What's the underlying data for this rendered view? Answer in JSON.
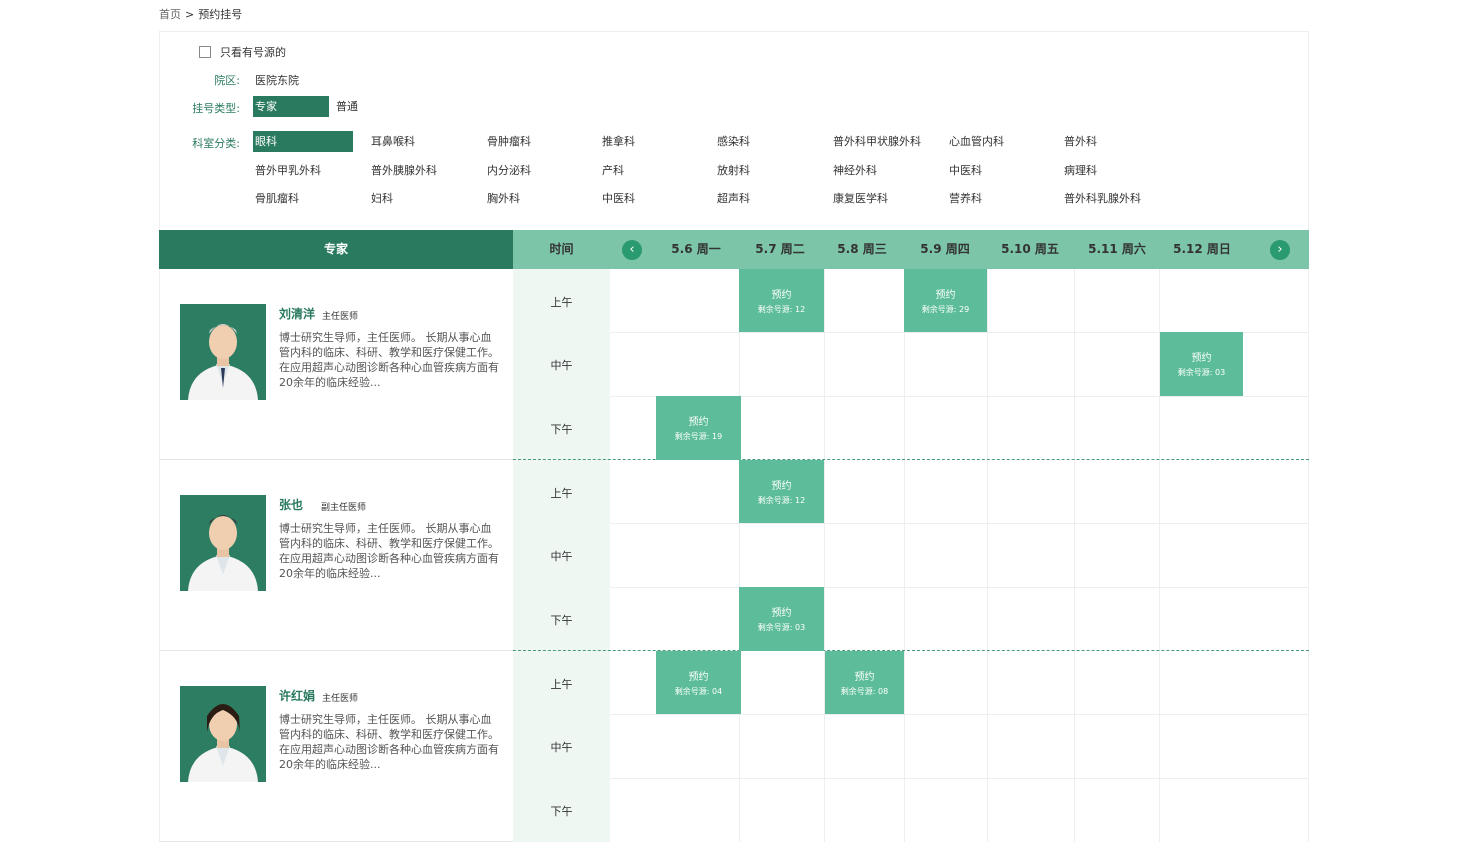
{
  "breadcrumb": {
    "home": "首页",
    "sep": ">",
    "current": "预约挂号"
  },
  "filters": {
    "only_available": "只看有号源的",
    "campus_label": "院区:",
    "campus_value": "医院东院",
    "type_label": "挂号类型:",
    "types": [
      "专家",
      "普通"
    ],
    "dept_label": "科室分类:",
    "depts": [
      [
        "眼科",
        "耳鼻喉科",
        "骨肿瘤科",
        "推拿科",
        "感染科",
        "普外科甲状腺外科",
        "心血管内科",
        "普外科"
      ],
      [
        "普外甲乳外科",
        "普外胰腺外科",
        "内分泌科",
        "产科",
        "放射科",
        "神经外科",
        "中医科",
        "病理科"
      ],
      [
        "骨肌瘤科",
        "妇科",
        "胸外科",
        "中医科",
        "超声科",
        "康复医学科",
        "营养科",
        "普外科乳腺外科"
      ]
    ]
  },
  "schedule": {
    "expert_header": "专家",
    "time_header": "时间",
    "prev_icon": "‹",
    "next_icon": "›",
    "dates": [
      "5.6 周一",
      "5.7 周二",
      "5.8 周三",
      "5.9 周四",
      "5.10 周五",
      "5.11 周六",
      "5.12 周日"
    ],
    "slots": [
      "上午",
      "中午",
      "下午"
    ],
    "book_label": "预约",
    "remain_prefix": "剩余号源:"
  },
  "doctors": [
    {
      "name": "刘清洋",
      "title": "主任医师",
      "desc": "博士研究生导师，主任医师。 长期从事心血管内科的临床、科研、教学和医疗保健工作。在应用超声心动图诊断各种心血管疾病方面有20余年的临床经验...",
      "bookings": [
        {
          "slot": 0,
          "day": 1,
          "remain": "12"
        },
        {
          "slot": 0,
          "day": 3,
          "remain": "29"
        },
        {
          "slot": 1,
          "day": 6,
          "remain": "03"
        },
        {
          "slot": 2,
          "day": 0,
          "remain": "19"
        }
      ]
    },
    {
      "name": "张也",
      "title": "副主任医师",
      "desc": "博士研究生导师，主任医师。 长期从事心血管内科的临床、科研、教学和医疗保健工作。在应用超声心动图诊断各种心血管疾病方面有20余年的临床经验...",
      "bookings": [
        {
          "slot": 0,
          "day": 1,
          "remain": "12"
        },
        {
          "slot": 2,
          "day": 1,
          "remain": "03"
        }
      ]
    },
    {
      "name": "许红娟",
      "title": "主任医师",
      "desc": "博士研究生导师，主任医师。 长期从事心血管内科的临床、科研、教学和医疗保健工作。在应用超声心动图诊断各种心血管疾病方面有20余年的临床经验...",
      "bookings": [
        {
          "slot": 0,
          "day": 0,
          "remain": "04"
        },
        {
          "slot": 0,
          "day": 2,
          "remain": "08"
        }
      ]
    }
  ]
}
